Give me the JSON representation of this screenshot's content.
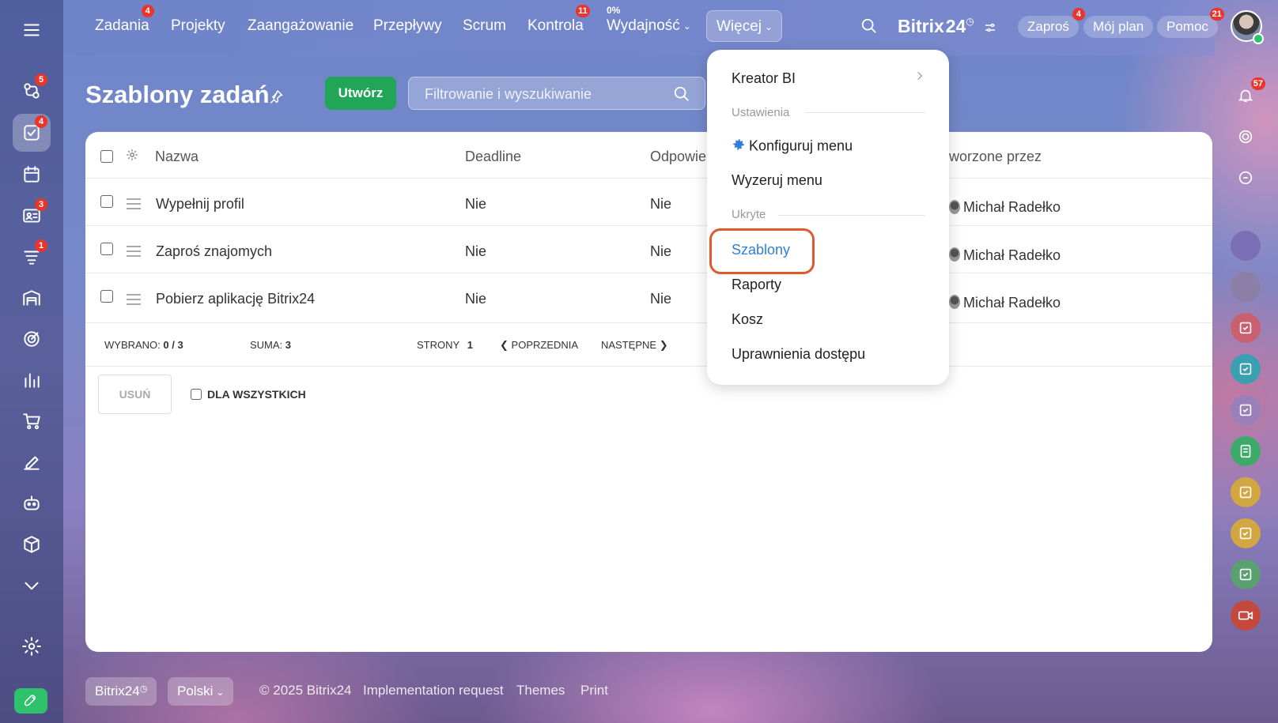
{
  "topnav": {
    "items": [
      {
        "label": "Zadania",
        "badge": "4"
      },
      {
        "label": "Projekty"
      },
      {
        "label": "Zaangażowanie"
      },
      {
        "label": "Przepływy"
      },
      {
        "label": "Scrum"
      },
      {
        "label": "Kontrola",
        "badge": "11"
      },
      {
        "label": "Wydajność",
        "pct": "0%"
      }
    ],
    "more_label": "Więcej",
    "brand": "Bitrix",
    "brand_num": "24",
    "invite": {
      "label": "Zaproś",
      "badge": "4"
    },
    "my_plan": "Mój plan",
    "help": {
      "label": "Pomoc",
      "badge": "21"
    }
  },
  "sidebar": {
    "badges": {
      "collab": "5",
      "tasks": "4",
      "crm": "3",
      "feed": "1"
    }
  },
  "rightbar": {
    "notif_badge": "57"
  },
  "page": {
    "title": "Szablony zadań",
    "create_label": "Utwórz",
    "filter_placeholder": "Filtrowanie i wyszukiwanie"
  },
  "table": {
    "headers": {
      "name": "Nazwa",
      "deadline": "Deadline",
      "responsible": "Odpowie",
      "created_by": "worzone przez"
    },
    "rows": [
      {
        "name": "Wypełnij profil",
        "deadline": "Nie",
        "responsible": "Nie",
        "created_by": "Michał Radełko"
      },
      {
        "name": "Zaproś znajomych",
        "deadline": "Nie",
        "responsible": "Nie",
        "created_by": "Michał Radełko"
      },
      {
        "name": "Pobierz aplikację Bitrix24",
        "deadline": "Nie",
        "responsible": "Nie",
        "created_by": "Michał Radełko"
      }
    ],
    "footer": {
      "selected_label": "WYBRANO:",
      "selected_value": "0 / 3",
      "sum_label": "SUMA:",
      "sum_value": "3",
      "pages_label": "STRONY",
      "pages_value": "1",
      "prev": "POPRZEDNIA",
      "next": "NASTĘPNE"
    },
    "delete_label": "USUŃ",
    "for_all_label": "DLA WSZYSTKICH"
  },
  "dropdown": {
    "bi": "Kreator BI",
    "settings_section": "Ustawienia",
    "configure": "Konfiguruj menu",
    "reset": "Wyzeruj menu",
    "hidden_section": "Ukryte",
    "templates": "Szablony",
    "reports": "Raporty",
    "trash": "Kosz",
    "permissions": "Uprawnienia dostępu"
  },
  "footer": {
    "brand": "Bitrix24",
    "language": "Polski",
    "copyright": "© 2025 Bitrix24",
    "impl": "Implementation request",
    "themes": "Themes",
    "print": "Print"
  },
  "colors": {
    "accent_green": "#21a556",
    "highlight": "#e0592b",
    "link_blue": "#2f7fd8",
    "badge_red": "#e9352b"
  }
}
